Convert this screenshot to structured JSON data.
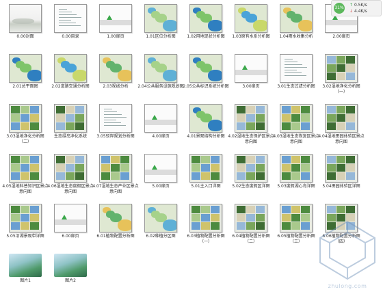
{
  "status_widget": {
    "percent": "31%",
    "upload": "0.5K/s",
    "download": "4.4K/s",
    "colors": {
      "badge": "#5cb85c",
      "up_arrow": "#3aa84a",
      "down_arrow": "#d9534f"
    }
  },
  "watermark_text": "zhulong.com",
  "files": [
    {
      "label": "0.00封面",
      "kind": "cover"
    },
    {
      "label": "0.00目录",
      "kind": "text"
    },
    {
      "label": "1.00扉页",
      "kind": "title"
    },
    {
      "label": "1.01区位分析图",
      "kind": "map"
    },
    {
      "label": "1.02用地现状分析图",
      "kind": "map"
    },
    {
      "label": "1.03原有水系分析图",
      "kind": "map"
    },
    {
      "label": "1.04雨水收集分析",
      "kind": "map"
    },
    {
      "label": "2.00扉页",
      "kind": "title"
    },
    {
      "label": "2.01总平面图",
      "kind": "map"
    },
    {
      "label": "2.02道路交通分析图",
      "kind": "map"
    },
    {
      "label": "2.03视线分析",
      "kind": "map"
    },
    {
      "label": "2.04公共服务设施规划图",
      "kind": "map"
    },
    {
      "label": "2.05公共标识系统分析图",
      "kind": "map"
    },
    {
      "label": "3.00扉页",
      "kind": "title"
    },
    {
      "label": "3.01生态过滤分析图",
      "kind": "text"
    },
    {
      "label": "3.02湿地净化分析图（一）",
      "kind": "photo"
    },
    {
      "label": "3.03湿地净化分析图（二）",
      "kind": "photo"
    },
    {
      "label": "生态绿岛净化系统",
      "kind": "photo"
    },
    {
      "label": "3.05驳岸规划分析图",
      "kind": "text"
    },
    {
      "label": "4.00扉页",
      "kind": "title"
    },
    {
      "label": "4.01景观结构分析图",
      "kind": "map"
    },
    {
      "label": "4.02湿地生态保护区景点意向图",
      "kind": "photo"
    },
    {
      "label": "4.03湿地生态恢复区景点意向图",
      "kind": "photo"
    },
    {
      "label": "4.04湿地田园体验区景点意向图",
      "kind": "photo"
    },
    {
      "label": "4.05湿地科普知识区景点意向图",
      "kind": "photo"
    },
    {
      "label": "4.06湿地生态度假区景点意向图",
      "kind": "photo"
    },
    {
      "label": "4.07湿地生态产业区景点意向图",
      "kind": "photo"
    },
    {
      "label": "5.00扉页",
      "kind": "title"
    },
    {
      "label": "5.01主入口详图",
      "kind": "photo"
    },
    {
      "label": "5.02生态度假区详图",
      "kind": "photo"
    },
    {
      "label": "5.03度假湖心岛详图",
      "kind": "photo"
    },
    {
      "label": "5.04田园体验区详图",
      "kind": "photo"
    },
    {
      "label": "5.05沿湖景观带详图",
      "kind": "photo"
    },
    {
      "label": "6.00扉页",
      "kind": "title"
    },
    {
      "label": "6.01植物配置分析图",
      "kind": "map"
    },
    {
      "label": "6.02种植分区图",
      "kind": "map"
    },
    {
      "label": "6.03植物配置分析图（一）",
      "kind": "photo"
    },
    {
      "label": "6.04植物配置分析图（二）",
      "kind": "photo"
    },
    {
      "label": "6.05植物配置分析图（三）",
      "kind": "photo"
    },
    {
      "label": "6.06植物配置分析图（四）",
      "kind": "photo"
    },
    {
      "label": "图片1",
      "kind": "aerial"
    },
    {
      "label": "图片2",
      "kind": "aerial"
    }
  ]
}
